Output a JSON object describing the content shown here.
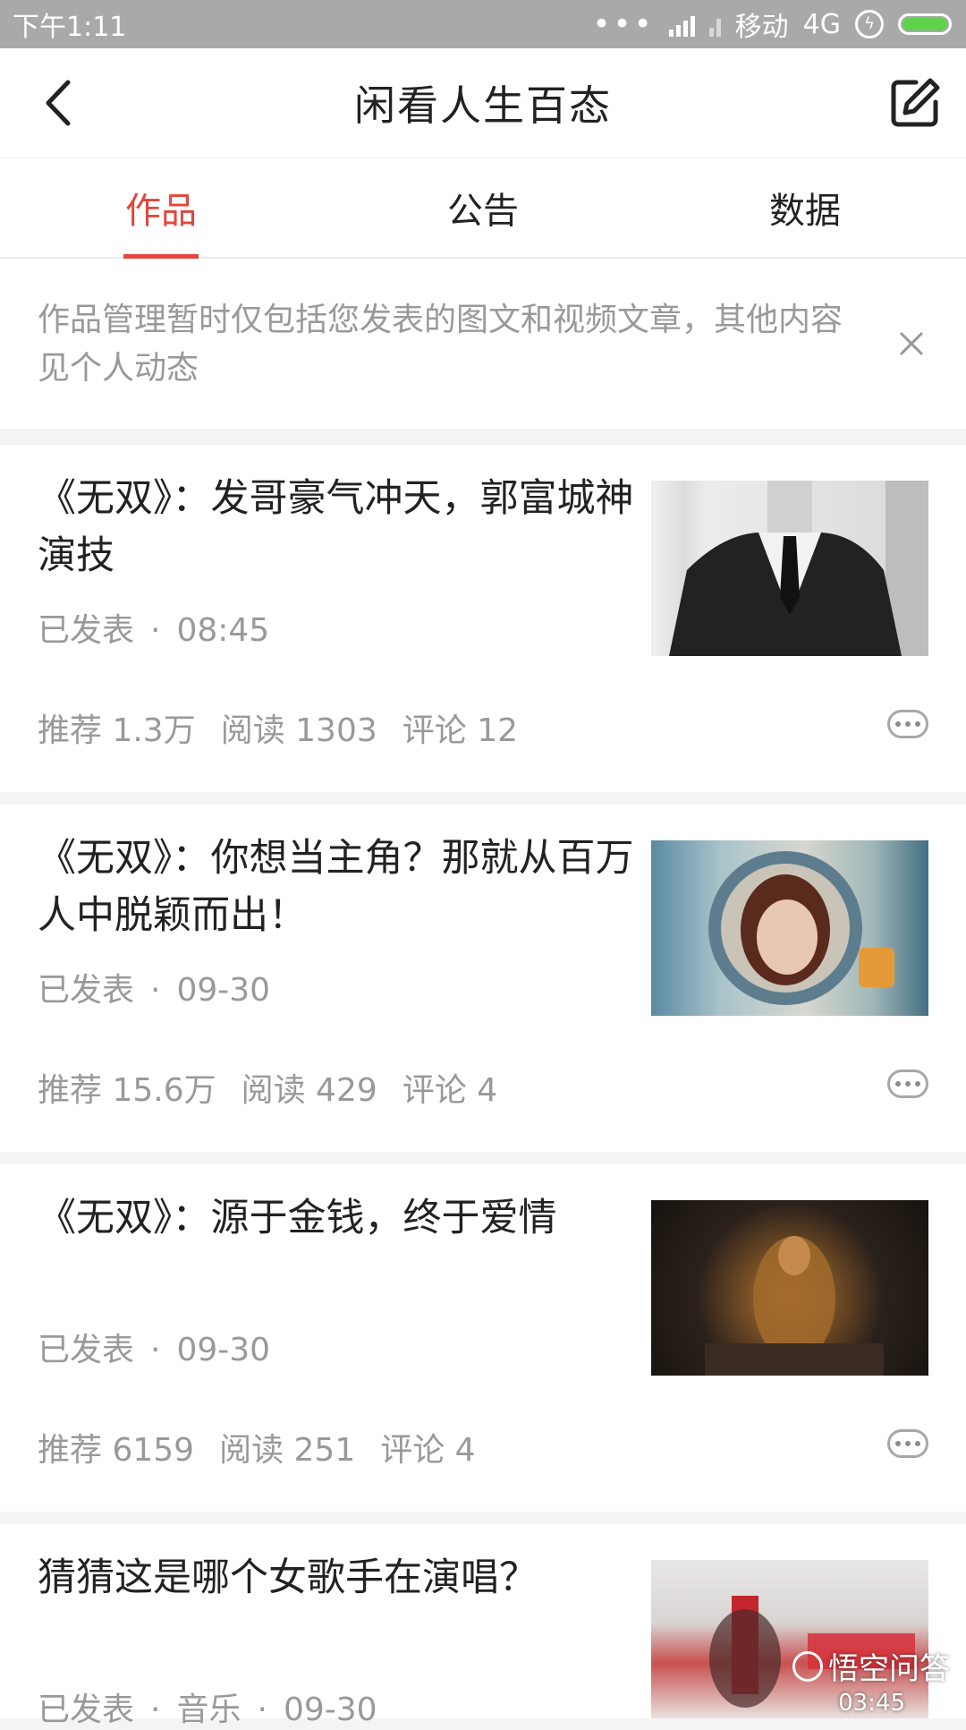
{
  "status_bar": {
    "time": "下午1:11",
    "carrier": "移动",
    "network": "4G"
  },
  "header": {
    "title": "闲看人生百态",
    "back_icon": "chevron-left-icon",
    "edit_icon": "edit-icon"
  },
  "tabs": [
    {
      "label": "作品",
      "active": true
    },
    {
      "label": "公告",
      "active": false
    },
    {
      "label": "数据",
      "active": false
    }
  ],
  "notice": {
    "text": "作品管理暂时仅包括您发表的图文和视频文章，其他内容见个人动态",
    "close_icon": "close-icon"
  },
  "articles": [
    {
      "title": "《无双》：发哥豪气冲天，郭富城神演技",
      "status": "已发表",
      "time": "08:45",
      "stats": {
        "recommend": "推荐 1.3万",
        "read": "阅读 1303",
        "comment": "评论 12"
      }
    },
    {
      "title": "《无双》：你想当主角？那就从百万人中脱颖而出！",
      "status": "已发表",
      "time": "09-30",
      "stats": {
        "recommend": "推荐 15.6万",
        "read": "阅读 429",
        "comment": "评论 4"
      }
    },
    {
      "title": "《无双》：源于金钱，终于爱情",
      "status": "已发表",
      "time": "09-30",
      "stats": {
        "recommend": "推荐 6159",
        "read": "阅读 251",
        "comment": "评论 4"
      }
    },
    {
      "title": "猜猜这是哪个女歌手在演唱？",
      "status": "已发表",
      "category": "音乐",
      "time": "09-30"
    }
  ],
  "overlay": {
    "watermark": "悟空问答",
    "video_duration": "03:45"
  },
  "colors": {
    "accent": "#e3463c",
    "status_bar": "#a9a9a9",
    "muted_text": "#999999"
  }
}
